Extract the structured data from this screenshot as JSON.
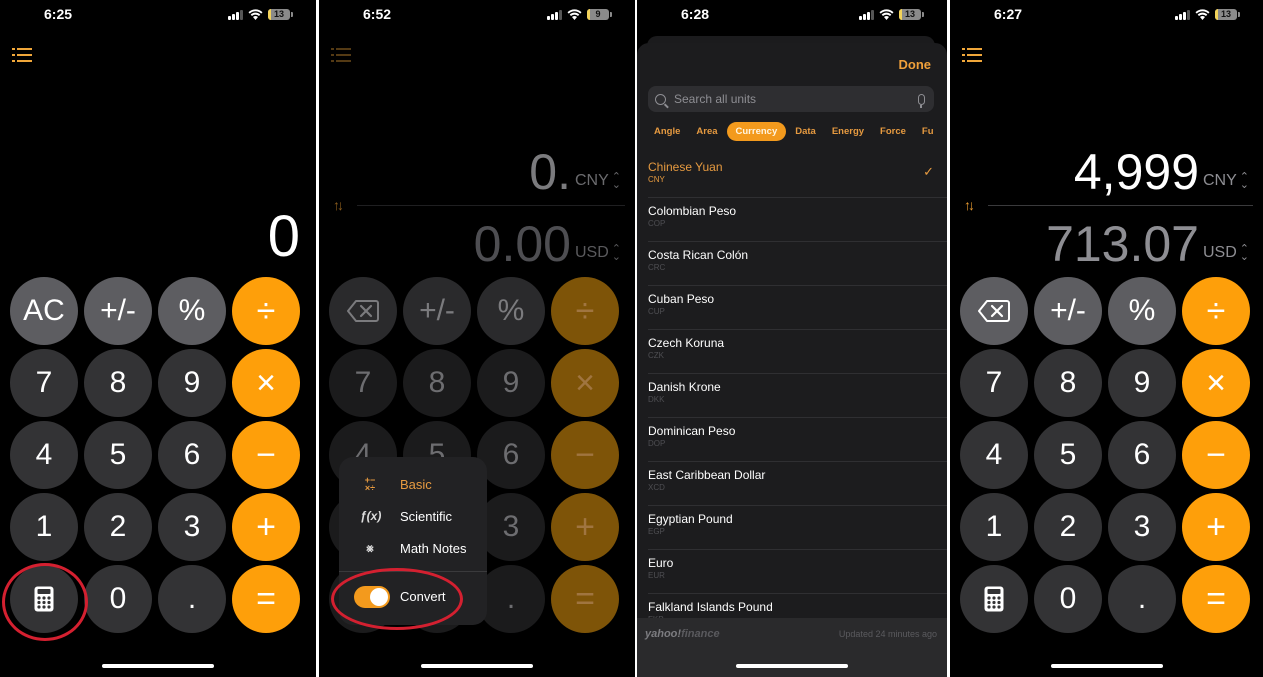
{
  "colors": {
    "accent": "#fe9f0a",
    "highlight_ring": "#d42030",
    "background": "#000000"
  },
  "screens": [
    {
      "status": {
        "time": "6:25",
        "battery": "13"
      },
      "display": "0",
      "keys": [
        "AC",
        "+/-",
        "%",
        "÷",
        "7",
        "8",
        "9",
        "×",
        "4",
        "5",
        "6",
        "−",
        "1",
        "2",
        "3",
        "+",
        "calculator-icon",
        "0",
        ".",
        "="
      ]
    },
    {
      "status": {
        "time": "6:52",
        "battery": "9"
      },
      "from": {
        "value": "0.",
        "unit": "CNY"
      },
      "to": {
        "value": "0.00",
        "unit": "USD"
      },
      "keys": [
        "backspace-icon",
        "+/-",
        "%",
        "÷",
        "7",
        "8",
        "9",
        "×",
        "4",
        "5",
        "6",
        "−",
        "1",
        "2",
        "3",
        "+",
        "calculator-icon",
        "0",
        ".",
        "="
      ],
      "menu": {
        "items": [
          {
            "icon": "+−×÷",
            "label": "Basic",
            "active": true
          },
          {
            "icon": "ƒ(x)",
            "label": "Scientific",
            "active": false
          },
          {
            "icon": "y/x",
            "label": "Math Notes",
            "active": false
          }
        ],
        "toggle_label": "Convert",
        "toggle_on": true
      }
    },
    {
      "status": {
        "time": "6:28",
        "battery": "13"
      },
      "done_label": "Done",
      "search_placeholder": "Search all units",
      "categories": [
        "Angle",
        "Area",
        "Currency",
        "Data",
        "Energy",
        "Force",
        "Fu"
      ],
      "selected_category": "Currency",
      "currencies": [
        {
          "name": "Chinese Yuan",
          "code": "CNY",
          "selected": true
        },
        {
          "name": "Colombian Peso",
          "code": "COP"
        },
        {
          "name": "Costa Rican Colón",
          "code": "CRC"
        },
        {
          "name": "Cuban Peso",
          "code": "CUP"
        },
        {
          "name": "Czech Koruna",
          "code": "CZK"
        },
        {
          "name": "Danish Krone",
          "code": "DKK"
        },
        {
          "name": "Dominican Peso",
          "code": "DOP"
        },
        {
          "name": "East Caribbean Dollar",
          "code": "XCD"
        },
        {
          "name": "Egyptian Pound",
          "code": "EGP"
        },
        {
          "name": "Euro",
          "code": "EUR"
        },
        {
          "name": "Falkland Islands Pound",
          "code": "FKP"
        }
      ],
      "footer": {
        "brand_a": "yahoo!",
        "brand_b": "finance",
        "updated": "Updated 24 minutes ago"
      }
    },
    {
      "status": {
        "time": "6:27",
        "battery": "13"
      },
      "from": {
        "value": "4,999",
        "unit": "CNY"
      },
      "to": {
        "value": "713.07",
        "unit": "USD"
      },
      "keys": [
        "backspace-icon",
        "+/-",
        "%",
        "÷",
        "7",
        "8",
        "9",
        "×",
        "4",
        "5",
        "6",
        "−",
        "1",
        "2",
        "3",
        "+",
        "calculator-icon",
        "0",
        ".",
        "="
      ]
    }
  ]
}
